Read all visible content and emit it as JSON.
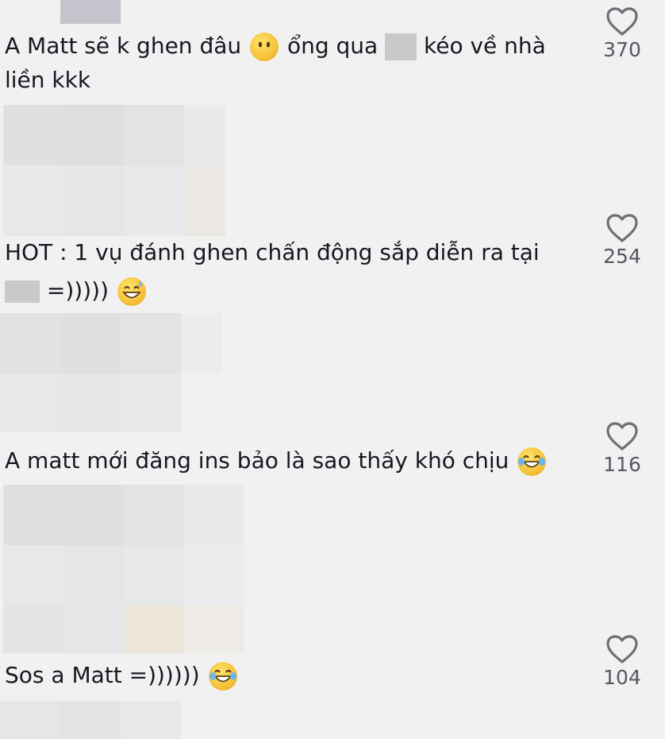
{
  "comments": [
    {
      "text_a": "A Matt sẽ k ghen đâu",
      "emoji_1": "face-without-mouth-emoji",
      "text_b": "ổng qua",
      "text_c": "kéo về nhà",
      "text_line2": "liền kkk",
      "likes": "370"
    },
    {
      "text_a": "HOT : 1 vụ đánh ghen chấn động sắp diễn ra tại",
      "text_b": "=)))))",
      "emoji_1": "grinning-sweat-emoji",
      "likes": "254"
    },
    {
      "text_a": "A matt mới đăng ins bảo là sao thấy khó chịu",
      "emoji_1": "tears-of-joy-emoji",
      "likes": "116"
    },
    {
      "text_a": "Sos a Matt =))))))",
      "emoji_1": "tears-of-joy-emoji",
      "likes": "104"
    }
  ]
}
